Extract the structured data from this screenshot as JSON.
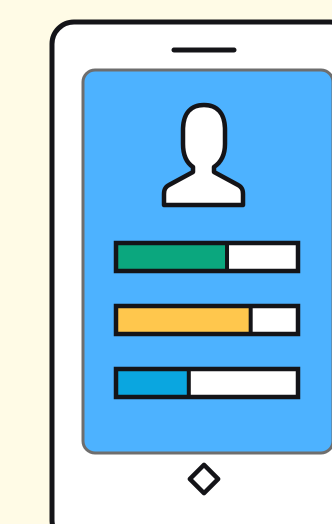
{
  "colors": {
    "background": "#fffbe6",
    "phone_body": "#ffffff",
    "outline": "#141418",
    "screen_fill": "#4db2ff",
    "screen_border": "#6e6e6e",
    "avatar_fill": "#ffffff",
    "bar_track": "#ffffff"
  },
  "icons": {
    "speaker": "speaker-slot-icon",
    "avatar": "user-avatar-icon",
    "home_button": "diamond-home-icon"
  },
  "progress_bars": [
    {
      "name": "progress-bar-green",
      "color": "#0ba77e",
      "fraction": 0.61
    },
    {
      "name": "progress-bar-yellow",
      "color": "#ffc74d",
      "fraction": 0.74
    },
    {
      "name": "progress-bar-blue",
      "color": "#0aa6e0",
      "fraction": 0.4
    }
  ]
}
